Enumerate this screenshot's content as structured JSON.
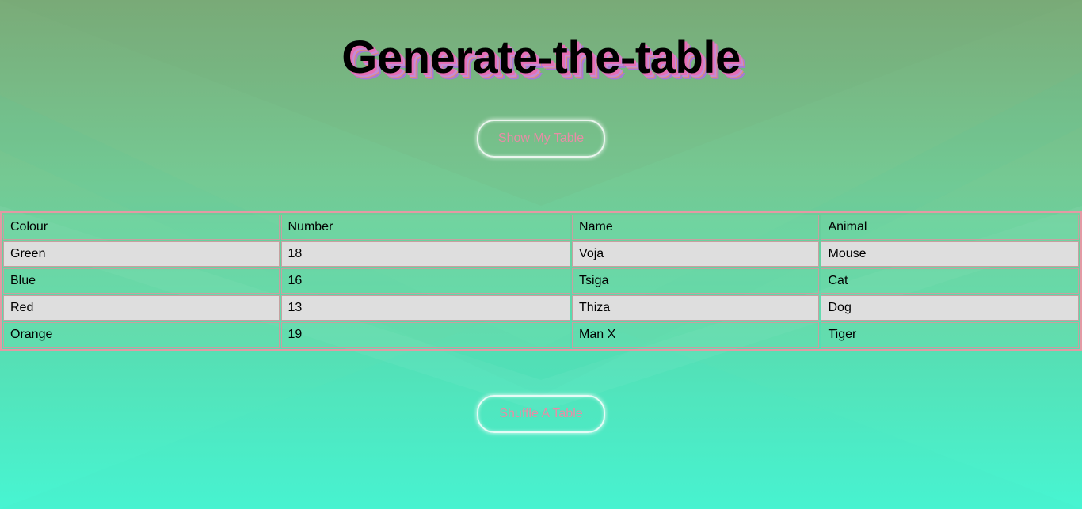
{
  "page": {
    "title": "Generate-the-table"
  },
  "buttons": {
    "show_label": "Show My Table",
    "shuffle_label": "Shuffle A Table"
  },
  "table": {
    "headers": [
      "Colour",
      "Number",
      "Name",
      "Animal"
    ],
    "rows": [
      [
        "Green",
        "18",
        "Voja",
        "Mouse"
      ],
      [
        "Blue",
        "16",
        "Tsiga",
        "Cat"
      ],
      [
        "Red",
        "13",
        "Thiza",
        "Dog"
      ],
      [
        "Orange",
        "19",
        "Man X",
        "Tiger"
      ]
    ]
  },
  "colors": {
    "button_text": "#e88da6",
    "table_border": "#e39aa4",
    "grey_row": "#dedede"
  }
}
